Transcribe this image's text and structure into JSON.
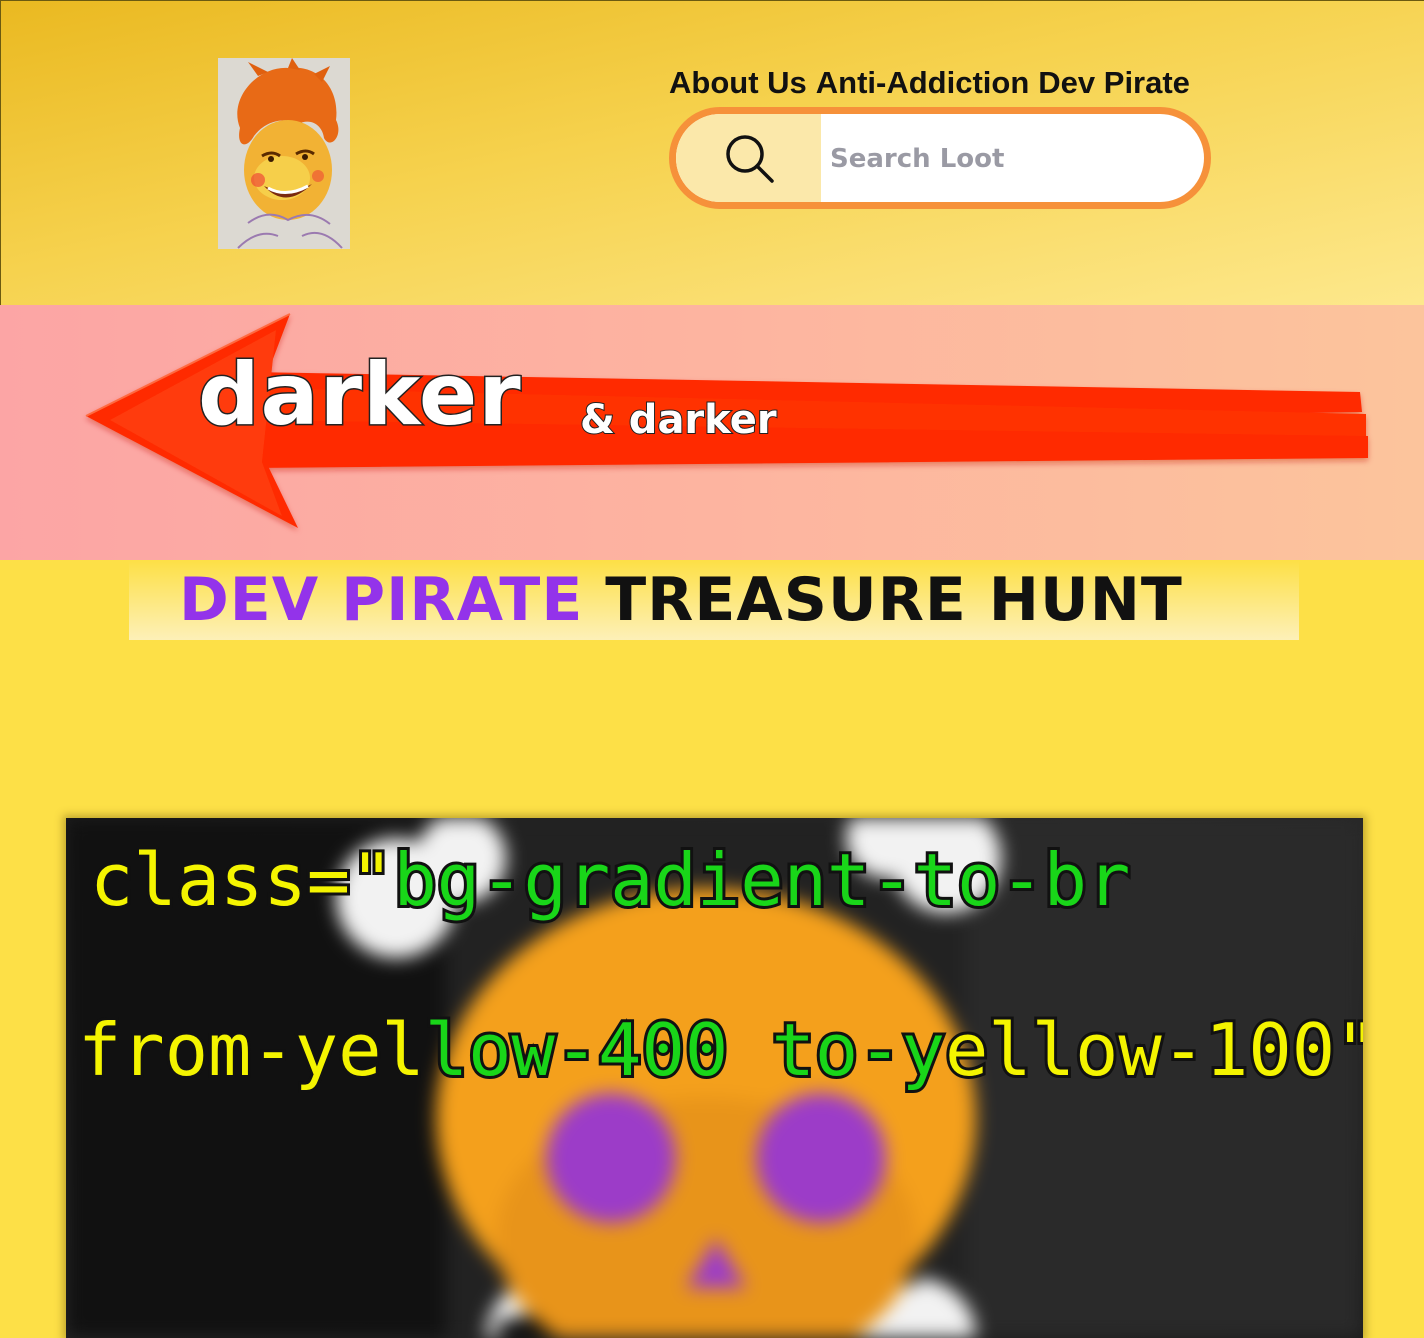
{
  "header": {
    "nav": [
      {
        "label": "About Us"
      },
      {
        "label": "Anti-Addiction"
      },
      {
        "label": "Dev Pirate"
      }
    ],
    "search": {
      "placeholder": "Search Loot",
      "icon": "search-icon"
    },
    "gradient_colors": [
      "#eab921",
      "#fde88c"
    ]
  },
  "banner": {
    "big_word": "darker",
    "small_text": "& darker",
    "arrow_color": "#ff2a00"
  },
  "heading": {
    "part1": "DEV PIRATE",
    "part2": "TREASURE HUNT",
    "part1_color": "#9333ea",
    "part2_color": "#111111"
  },
  "card": {
    "code": {
      "seg1": "class=\"",
      "seg2": "bg-gradient-to-br",
      "seg3": "from-yel",
      "seg4": "low-400 to-y",
      "seg5": "ellow-100\""
    },
    "colors": {
      "yellow": "#f4f400",
      "green": "#19d619",
      "skull": "#f4a01c",
      "eyes": "#9c3cc8"
    }
  }
}
